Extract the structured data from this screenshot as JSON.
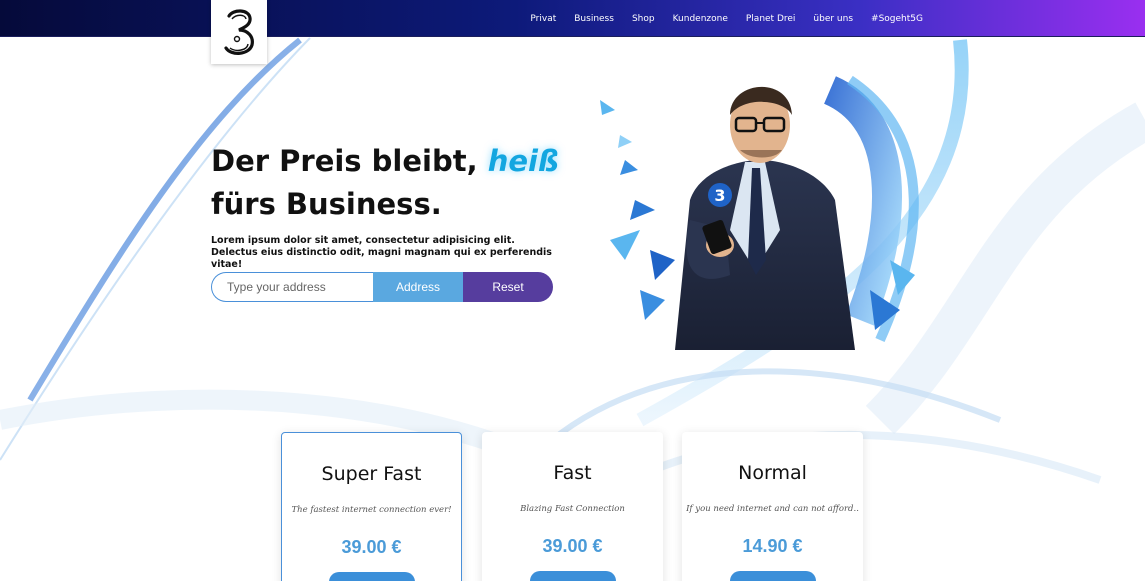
{
  "nav": {
    "items": [
      "Privat",
      "Business",
      "Shop",
      "Kundenzone",
      "Planet Drei",
      "über uns",
      "#Sogeht5G"
    ]
  },
  "hero": {
    "title_part1": "Der Preis bleibt,",
    "title_hot": "heiß",
    "title_part2": "fürs Business.",
    "text": "Lorem ipsum dolor sit amet, consectetur adipisicing elit. Delectus eius distinctio odit, magni magnam qui ex perferendis vitae!"
  },
  "form": {
    "placeholder": "Type your address",
    "address_label": "Address",
    "reset_label": "Reset"
  },
  "cards": [
    {
      "title": "Super Fast",
      "subtitle": "The fastest internet connection ever!",
      "price": "39.00 €"
    },
    {
      "title": "Fast",
      "subtitle": "Blazing Fast Connection",
      "price": "39.00 €"
    },
    {
      "title": "Normal",
      "subtitle": "If you need internet and can not afford..",
      "price": "14.90 €"
    }
  ],
  "colors": {
    "accent": "#4b9bd8",
    "reset_button": "#563d9e",
    "address_button": "#5aa8e0"
  }
}
